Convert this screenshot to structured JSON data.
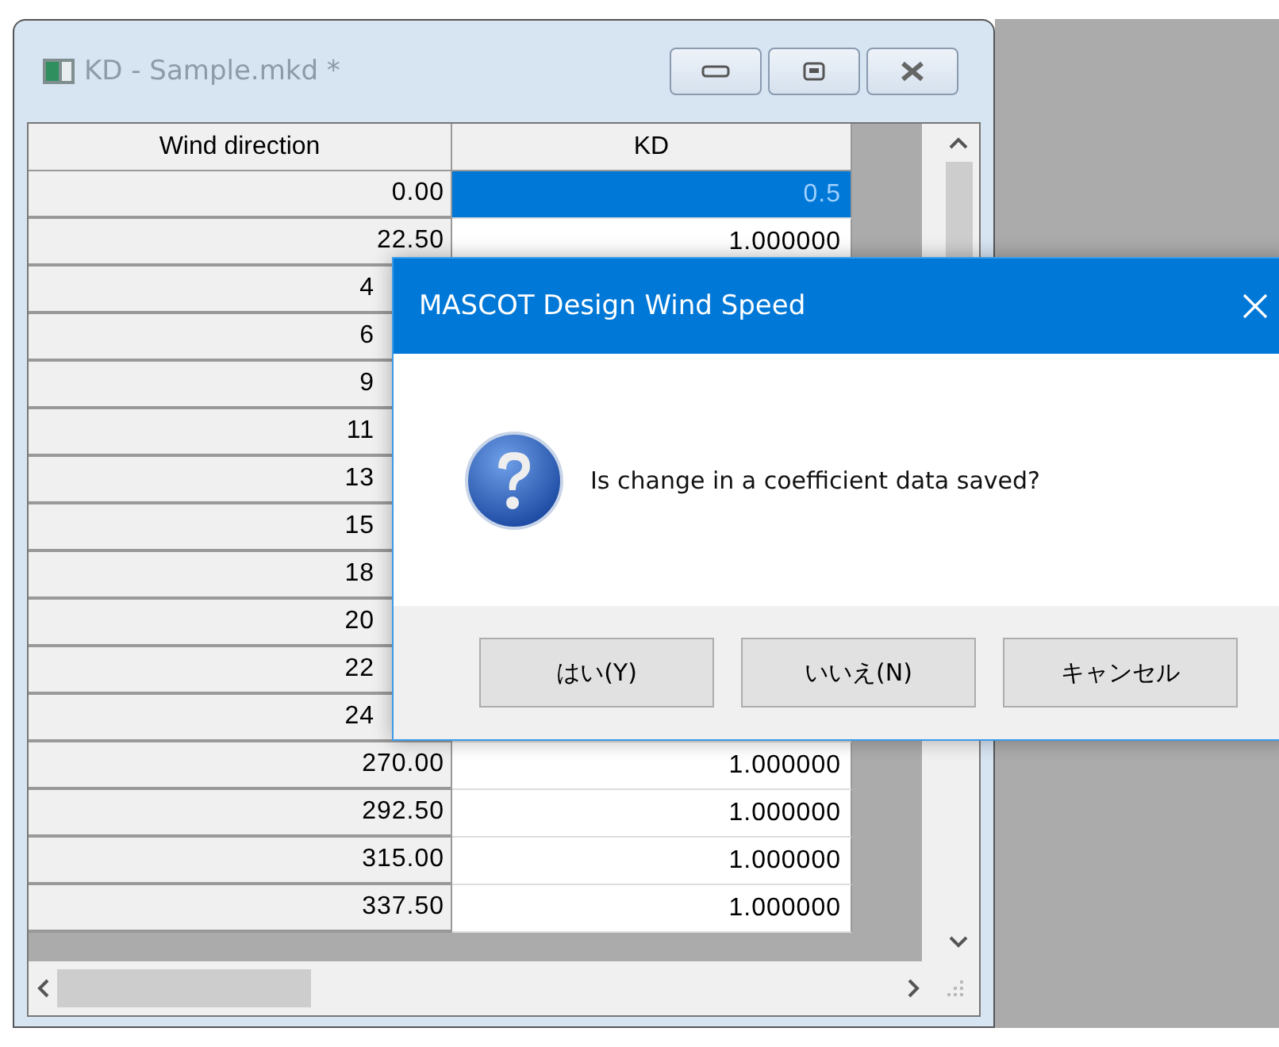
{
  "window": {
    "title": "KD - Sample.mkd *",
    "active": false
  },
  "table": {
    "columns": [
      "Wind direction",
      "KD"
    ],
    "rows": [
      {
        "wind_direction": "0.00",
        "kd": "0.5",
        "selected": true
      },
      {
        "wind_direction": "22.50",
        "kd": "1.000000",
        "selected": false
      },
      {
        "wind_direction": "4"
      },
      {
        "wind_direction": "6"
      },
      {
        "wind_direction": "9"
      },
      {
        "wind_direction": "11"
      },
      {
        "wind_direction": "13"
      },
      {
        "wind_direction": "15"
      },
      {
        "wind_direction": "18"
      },
      {
        "wind_direction": "20"
      },
      {
        "wind_direction": "22"
      },
      {
        "wind_direction": "24"
      },
      {
        "wind_direction": "270.00",
        "kd": "1.000000",
        "selected": false
      },
      {
        "wind_direction": "292.50",
        "kd": "1.000000",
        "selected": false
      },
      {
        "wind_direction": "315.00",
        "kd": "1.000000",
        "selected": false
      },
      {
        "wind_direction": "337.50",
        "kd": "1.000000",
        "selected": false
      }
    ]
  },
  "dialog": {
    "title": "MASCOT Design Wind Speed",
    "message": "Is change in a coefficient data saved?",
    "buttons": [
      "はい(Y)",
      "いいえ(N)",
      "キャンセル"
    ]
  }
}
